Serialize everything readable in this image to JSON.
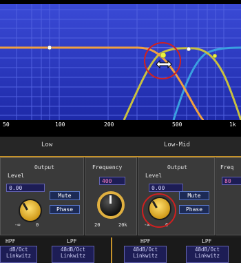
{
  "graph": {
    "freq_ticks": [
      "50",
      "100",
      "200",
      "500",
      "1k"
    ]
  },
  "bands": {
    "low": "Low",
    "low_mid": "Low-Mid"
  },
  "strips": {
    "low_output": {
      "title": "Output",
      "level_label": "Level",
      "level_value": "0.00",
      "mute_label": "Mute",
      "phase_label": "Phase",
      "scale_min": "-∞",
      "scale_max": "0"
    },
    "low_frequency": {
      "title": "Frequency",
      "value": "400",
      "scale_min": "20",
      "scale_max": "20k"
    },
    "lowmid_output": {
      "title": "Output",
      "level_label": "Level",
      "level_value": "0.00",
      "mute_label": "Mute",
      "phase_label": "Phase",
      "scale_min": "-∞",
      "scale_max": "0"
    },
    "lowmid_frequency": {
      "title_partial": "Freq",
      "value_partial": "80"
    }
  },
  "filters": {
    "hpf_label_1": "HPF",
    "lpf_label_1": "LPF",
    "hpf_label_2": "HPF",
    "lpf_label_2": "LPF",
    "slope_1": "dB/Oct",
    "type_1": "Linkwitz",
    "slope_2": "48dB/Oct",
    "type_2": "Linkwitz",
    "slope_3": "48dB/Oct",
    "type_3": "Linkwitz",
    "slope_4": "48dB/Oct",
    "type_4": "Linkwitz"
  },
  "colors": {
    "graph_bg": "#2a3ac0",
    "low_curve": "#f0a040",
    "lowmid_curve": "#c8c040",
    "mid_curve": "#3aa0e0",
    "highlight_circle": "#d02020",
    "band_underline": "#c5922a"
  }
}
